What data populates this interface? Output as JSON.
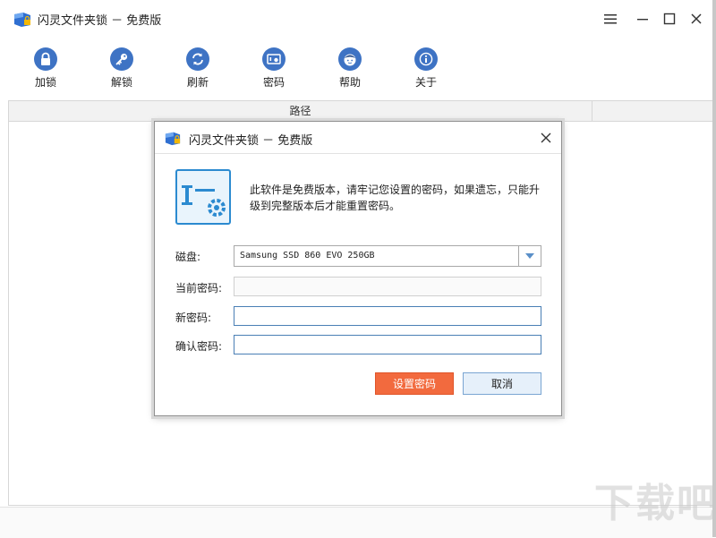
{
  "window": {
    "title": "闪灵文件夹锁 － 免费版"
  },
  "toolbar": {
    "items": [
      {
        "label": "加锁",
        "icon": "lock-icon"
      },
      {
        "label": "解锁",
        "icon": "key-icon"
      },
      {
        "label": "刷新",
        "icon": "refresh-icon"
      },
      {
        "label": "密码",
        "icon": "password-icon"
      },
      {
        "label": "帮助",
        "icon": "help-icon"
      },
      {
        "label": "关于",
        "icon": "info-icon"
      }
    ]
  },
  "table": {
    "columns": [
      "路径",
      ""
    ]
  },
  "dialog": {
    "title": "闪灵文件夹锁 － 免费版",
    "notice": "此软件是免费版本，请牢记您设置的密码，如果遗忘，只能升级到完整版本后才能重置密码。",
    "disk_label": "磁盘:",
    "disk_value": "Samsung SSD 860 EVO 250GB",
    "current_pw_label": "当前密码:",
    "current_pw_value": "",
    "new_pw_label": "新密码:",
    "new_pw_value": "",
    "confirm_pw_label": "确认密码:",
    "confirm_pw_value": "",
    "set_button": "设置密码",
    "cancel_button": "取消"
  },
  "watermark": "下载吧",
  "colors": {
    "accent_blue": "#3e73c4",
    "primary_button": "#f26a3e",
    "dialog_icon_border": "#2b8ad0"
  }
}
